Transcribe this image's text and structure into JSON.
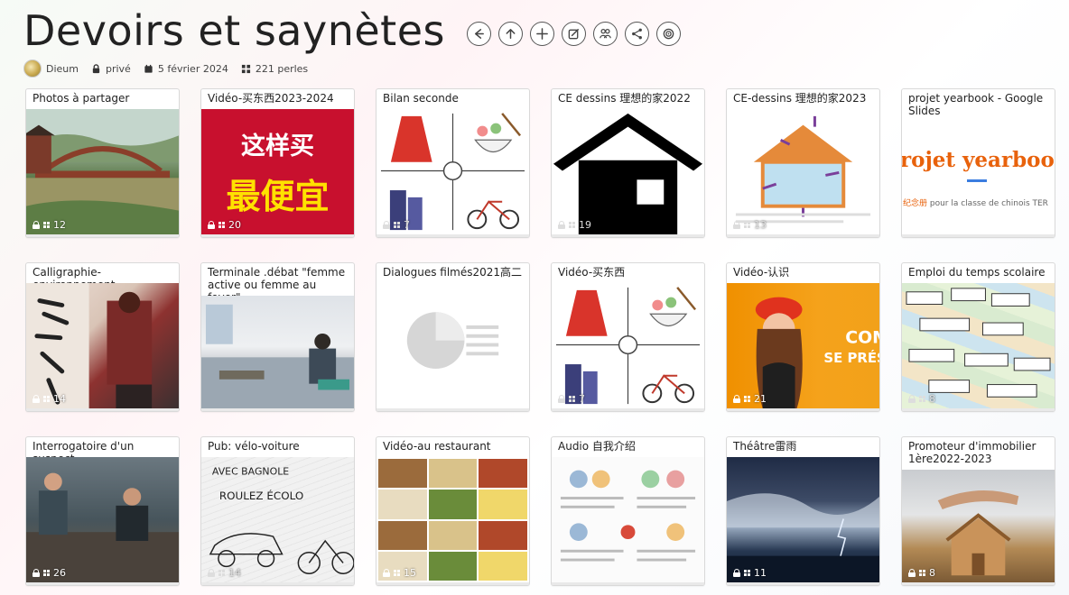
{
  "header": {
    "title": "Devoirs et saynètes",
    "actions": [
      "back-icon",
      "upload-icon",
      "add-icon",
      "edit-icon",
      "people-icon",
      "share-icon",
      "target-icon"
    ],
    "meta": {
      "author": "Dieum",
      "privacy": "privé",
      "date": "5 février 2024",
      "count": "221 perles"
    }
  },
  "cards": [
    {
      "title": "Photos à partager",
      "count": "12",
      "thumb": "landscape"
    },
    {
      "title": "Vidéo-买东西2023-2024",
      "count": "20",
      "thumb": "red",
      "thumb_text_1": "这样买",
      "thumb_text_2": "最便宜"
    },
    {
      "title": "Bilan seconde",
      "count": "7",
      "thumb": "illustration"
    },
    {
      "title": "CE dessins 理想的家2022",
      "count": "19",
      "thumb": "house"
    },
    {
      "title": "CE-dessins 理想的家2023",
      "count": "13",
      "thumb": "house-diagram"
    },
    {
      "title": "projet yearbook - Google Slides",
      "count": "",
      "thumb": "yearbook",
      "thumb_text_1": "rojet yearboo",
      "thumb_text_2": "纪念册",
      "thumb_text_3": " pour la classe de chinois TER"
    },
    {
      "title": "Calligraphie-environnement",
      "count": "14",
      "thumb": "photo-red"
    },
    {
      "title": "Terminale .débat \"femme active ou femme au foyer\"",
      "count": "",
      "thumb": "classroom"
    },
    {
      "title": "Dialogues filmés2021高二",
      "count": "",
      "thumb": "placeholder"
    },
    {
      "title": "Vidéo-买东西",
      "count": "7",
      "thumb": "illustration"
    },
    {
      "title": "Vidéo-认识",
      "count": "21",
      "thumb": "orange",
      "thumb_text_1": "COMM",
      "thumb_text_2": "SE PRÉS"
    },
    {
      "title": "Emploi du temps scolaire",
      "count": "8",
      "thumb": "words"
    },
    {
      "title": "Interrogatoire d'un suspect",
      "count": "26",
      "thumb": "interrog"
    },
    {
      "title": "Pub: vélo-voiture",
      "count": "14",
      "thumb": "sketch",
      "thumb_text_1": "AVEC BAGNOLE",
      "thumb_text_2": "ROULEZ ÉCOLO"
    },
    {
      "title": "Vidéo-au restaurant",
      "count": "15",
      "thumb": "food"
    },
    {
      "title": "Audio 自我介绍",
      "count": "",
      "thumb": "worksheet"
    },
    {
      "title": "Théâtre雷雨",
      "count": "11",
      "thumb": "storm"
    },
    {
      "title": "Promoteur d'immobilier 1ère2022-2023",
      "count": "8",
      "thumb": "house-photo"
    }
  ]
}
